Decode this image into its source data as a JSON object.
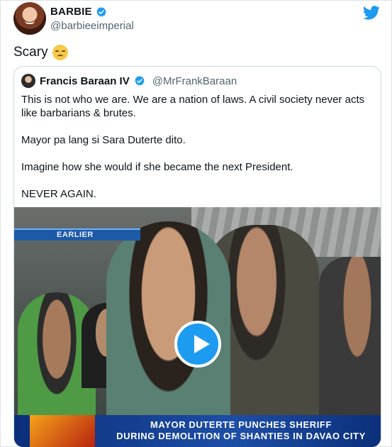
{
  "tweet": {
    "author": {
      "display_name": "BARBIE",
      "handle": "@barbieeimperial",
      "verified": true
    },
    "text": "Scary",
    "emoji": "pensive-face-emoji",
    "brand_icon": "twitter-bird-icon",
    "accent_color": "#1d9bf0"
  },
  "quote": {
    "author": {
      "display_name": "Francis Baraan IV",
      "handle": "@MrFrankBaraan",
      "verified": true
    },
    "paragraphs": [
      "This is not who we are. We are a nation of laws. A civil society never acts like barbarians & brutes.",
      "Mayor pa lang si Sara Duterte dito.",
      "Imagine how she would if she became the next President.",
      "NEVER AGAIN."
    ],
    "video": {
      "tag": "EARLIER",
      "caption_line1": "MAYOR DUTERTE PUNCHES SHERIFF",
      "caption_line2": "DURING DEMOLITION OF SHANTIES IN DAVAO CITY",
      "play_icon": "play-icon"
    }
  }
}
